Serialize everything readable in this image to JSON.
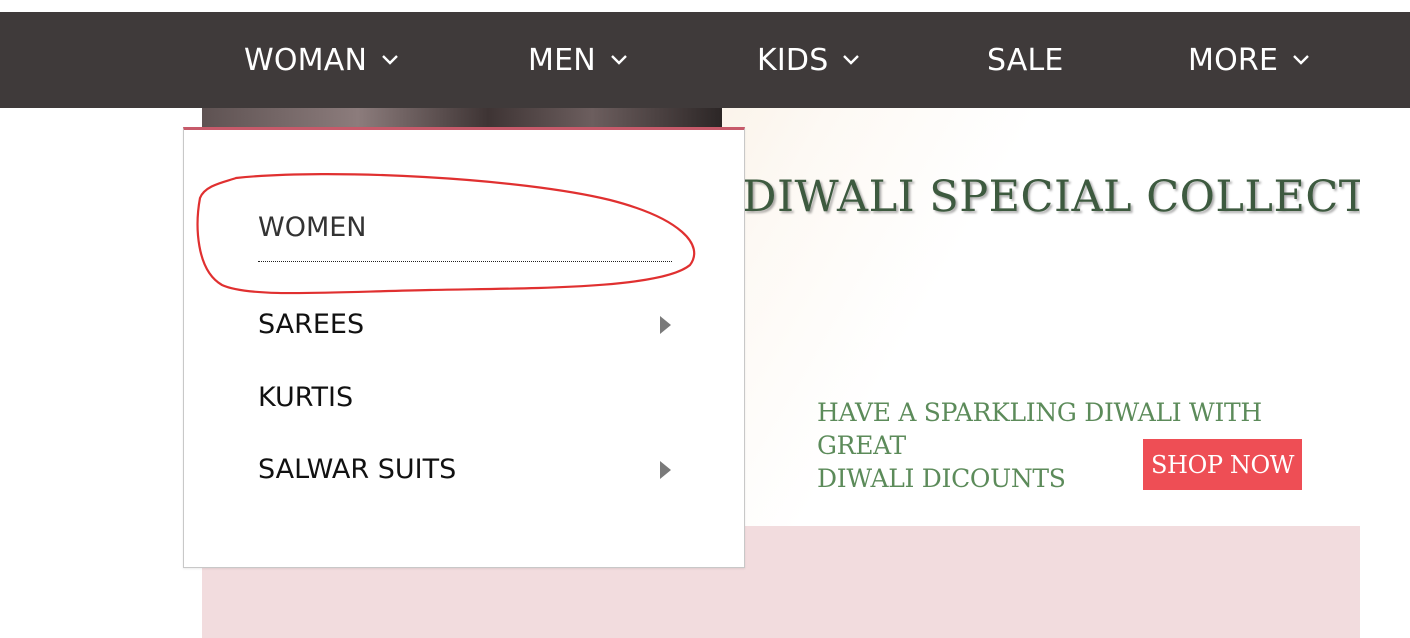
{
  "nav": {
    "items": [
      {
        "label": "WOMAN",
        "has_dropdown": true
      },
      {
        "label": "MEN",
        "has_dropdown": true
      },
      {
        "label": "KIDS",
        "has_dropdown": true
      },
      {
        "label": "SALE",
        "has_dropdown": false
      },
      {
        "label": "MORE",
        "has_dropdown": true
      }
    ],
    "background": "#3f3a3a",
    "text_color": "#ffffff"
  },
  "dropdown": {
    "heading": "WOMEN",
    "items": [
      {
        "label": "SAREES",
        "has_submenu": true
      },
      {
        "label": "KURTIS",
        "has_submenu": false
      },
      {
        "label": "SALWAR SUITS",
        "has_submenu": true
      }
    ],
    "accent": "#c75a6a",
    "annotation_color": "#e03030"
  },
  "banner": {
    "title": "DIWALI SPECIAL COLLECTION",
    "subtitle_line1": "HAVE A SPARKLING DIWALI WITH GREAT",
    "subtitle_line2": "DIWALI DICOUNTS",
    "cta": "SHOP NOW",
    "cta_color": "#ee4e55",
    "title_color": "#3d5a3f",
    "subtitle_color": "#5c8b5a",
    "strip_color": "#f2dcde"
  }
}
